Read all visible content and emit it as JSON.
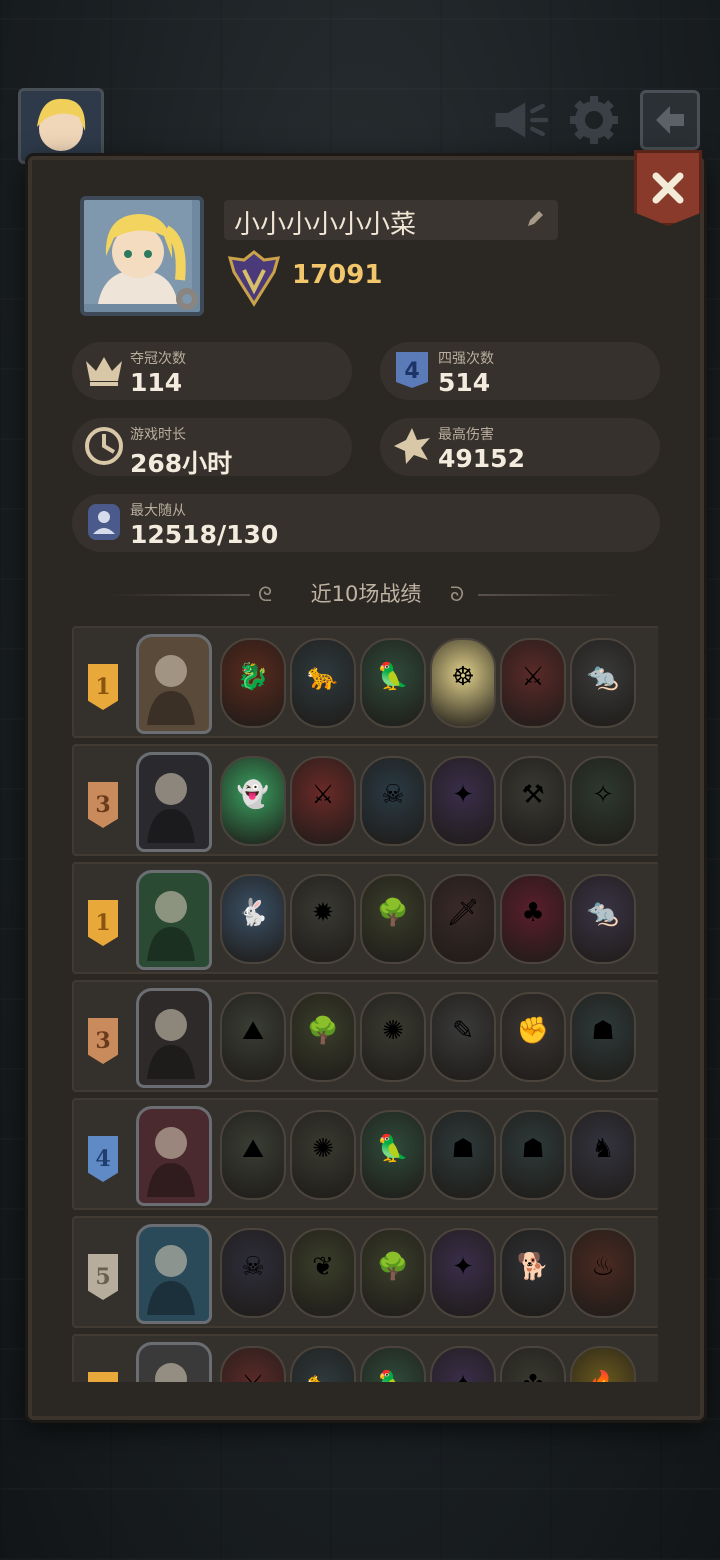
{
  "profile": {
    "name": "小小小小小小菜",
    "score": "17091"
  },
  "stats": {
    "championships": {
      "label": "夺冠次数",
      "value": "114"
    },
    "top4": {
      "label": "四强次数",
      "value": "514"
    },
    "playtime": {
      "label": "游戏时长",
      "value": "268小时"
    },
    "max_damage": {
      "label": "最高伤害",
      "value": "49152"
    },
    "max_followers": {
      "label": "最大随从",
      "value": "12518/130"
    }
  },
  "recent_title": "近10场战绩",
  "matches": [
    {
      "rank": "1",
      "tier": "gold",
      "leader_color": "#5a4a3a",
      "units": [
        {
          "bg": "#5a2a1e",
          "icon": "dragon-icon"
        },
        {
          "bg": "#2e3a3e",
          "icon": "panther-icon"
        },
        {
          "bg": "#2f4a3a",
          "icon": "parrot-icon"
        },
        {
          "bg": "#e0d08a",
          "icon": "monk-icon"
        },
        {
          "bg": "#5a2a28",
          "icon": "knight-icon"
        },
        {
          "bg": "#3a3a3a",
          "icon": "rat-icon"
        }
      ]
    },
    {
      "rank": "3",
      "tier": "bronze",
      "leader_color": "#2a2a2e",
      "units": [
        {
          "bg": "#3aa060",
          "icon": "ghost-icon"
        },
        {
          "bg": "#6a2a28",
          "icon": "knight-icon"
        },
        {
          "bg": "#2a3a44",
          "icon": "reaper-icon"
        },
        {
          "bg": "#3a2e4a",
          "icon": "shaman-icon"
        },
        {
          "bg": "#3a3a34",
          "icon": "warrior-icon"
        },
        {
          "bg": "#2e3a2e",
          "icon": "necro-icon"
        }
      ]
    },
    {
      "rank": "1",
      "tier": "gold",
      "leader_color": "#2a4a34",
      "units": [
        {
          "bg": "#3a5066",
          "icon": "bunny-icon"
        },
        {
          "bg": "#3a3a34",
          "icon": "bomb-icon"
        },
        {
          "bg": "#3a3e2a",
          "icon": "treant-icon"
        },
        {
          "bg": "#3a2a28",
          "icon": "rogue-icon"
        },
        {
          "bg": "#5a1e2a",
          "icon": "jester-icon"
        },
        {
          "bg": "#3a3446",
          "icon": "rat-icon"
        }
      ]
    },
    {
      "rank": "3",
      "tier": "bronze",
      "leader_color": "#2e2a2a",
      "units": [
        {
          "bg": "#3a3e34",
          "icon": "golem-icon"
        },
        {
          "bg": "#3a3e2a",
          "icon": "treant-icon"
        },
        {
          "bg": "#3a3a30",
          "icon": "hedgehog-icon"
        },
        {
          "bg": "#3a3a3a",
          "icon": "scholar-icon"
        },
        {
          "bg": "#3a3634",
          "icon": "ogre-icon"
        },
        {
          "bg": "#2e3a3a",
          "icon": "goblin-icon"
        }
      ]
    },
    {
      "rank": "4",
      "tier": "blue",
      "leader_color": "#4a2a2e",
      "units": [
        {
          "bg": "#3a3e34",
          "icon": "golem-icon"
        },
        {
          "bg": "#3a3a30",
          "icon": "hedgehog-icon"
        },
        {
          "bg": "#2f4a3a",
          "icon": "parrot-icon"
        },
        {
          "bg": "#2e3a3a",
          "icon": "goblin-icon"
        },
        {
          "bg": "#2e3a3a",
          "icon": "goblin-icon"
        },
        {
          "bg": "#34343e",
          "icon": "horse-icon"
        }
      ]
    },
    {
      "rank": "5",
      "tier": "gray",
      "leader_color": "#2a4a5a",
      "units": [
        {
          "bg": "#2e2e3a",
          "icon": "reaper-icon"
        },
        {
          "bg": "#3a3e2a",
          "icon": "sprout-icon"
        },
        {
          "bg": "#3a3e2a",
          "icon": "treant-icon"
        },
        {
          "bg": "#3a2e4a",
          "icon": "shaman-icon"
        },
        {
          "bg": "#2e3034",
          "icon": "hound-icon"
        },
        {
          "bg": "#4a2a22",
          "icon": "imp-icon"
        }
      ]
    },
    {
      "rank": "",
      "tier": "gold",
      "leader_color": "#3a3a3a",
      "units": [
        {
          "bg": "#5a2a28",
          "icon": "knight-icon"
        },
        {
          "bg": "#2e3a3e",
          "icon": "panther-icon"
        },
        {
          "bg": "#2f4a3a",
          "icon": "parrot-icon"
        },
        {
          "bg": "#3a2e4a",
          "icon": "shaman-icon"
        },
        {
          "bg": "#3a3a30",
          "icon": "beast-icon"
        },
        {
          "bg": "#6a5a1e",
          "icon": "fire-icon"
        }
      ]
    }
  ],
  "colors": {
    "accent_gold": "#f2c66a",
    "panel": "#2b2723",
    "close": "#8a3a2a"
  }
}
